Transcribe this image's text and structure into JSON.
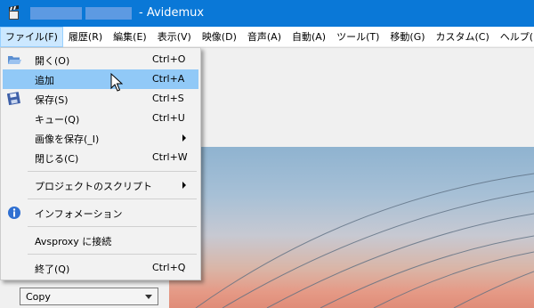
{
  "window": {
    "title": "- Avidemux",
    "app_icon": "clapperboard-icon"
  },
  "menubar": {
    "items": [
      {
        "label": "ファイル(F)",
        "active": true
      },
      {
        "label": "履歴(R)"
      },
      {
        "label": "編集(E)"
      },
      {
        "label": "表示(V)"
      },
      {
        "label": "映像(D)"
      },
      {
        "label": "音声(A)"
      },
      {
        "label": "自動(A)"
      },
      {
        "label": "ツール(T)"
      },
      {
        "label": "移動(G)"
      },
      {
        "label": "カスタム(C)"
      },
      {
        "label": "ヘルプ(H)"
      }
    ]
  },
  "file_menu": {
    "items": [
      {
        "label": "開く(O)",
        "shortcut": "Ctrl+O",
        "icon": "folder-open-icon"
      },
      {
        "label": "追加",
        "shortcut": "Ctrl+A",
        "highlighted": true
      },
      {
        "label": "保存(S)",
        "shortcut": "Ctrl+S",
        "icon": "save-icon"
      },
      {
        "label": "キュー(Q)",
        "shortcut": "Ctrl+U"
      },
      {
        "label": "画像を保存(_I)",
        "submenu": true
      },
      {
        "label": "閉じる(C)",
        "shortcut": "Ctrl+W"
      },
      {
        "label": "プロジェクトのスクリプト",
        "submenu": true
      },
      {
        "label": "インフォメーション",
        "icon": "info-icon"
      },
      {
        "label": "Avsproxy に接続"
      },
      {
        "label": "終了(Q)",
        "shortcut": "Ctrl+Q"
      }
    ]
  },
  "codec_select": {
    "value": "Copy"
  },
  "colors": {
    "titlebar": "#0a78d7",
    "menu_highlight": "#91c9f7",
    "menubar_active": "#cce8ff"
  }
}
